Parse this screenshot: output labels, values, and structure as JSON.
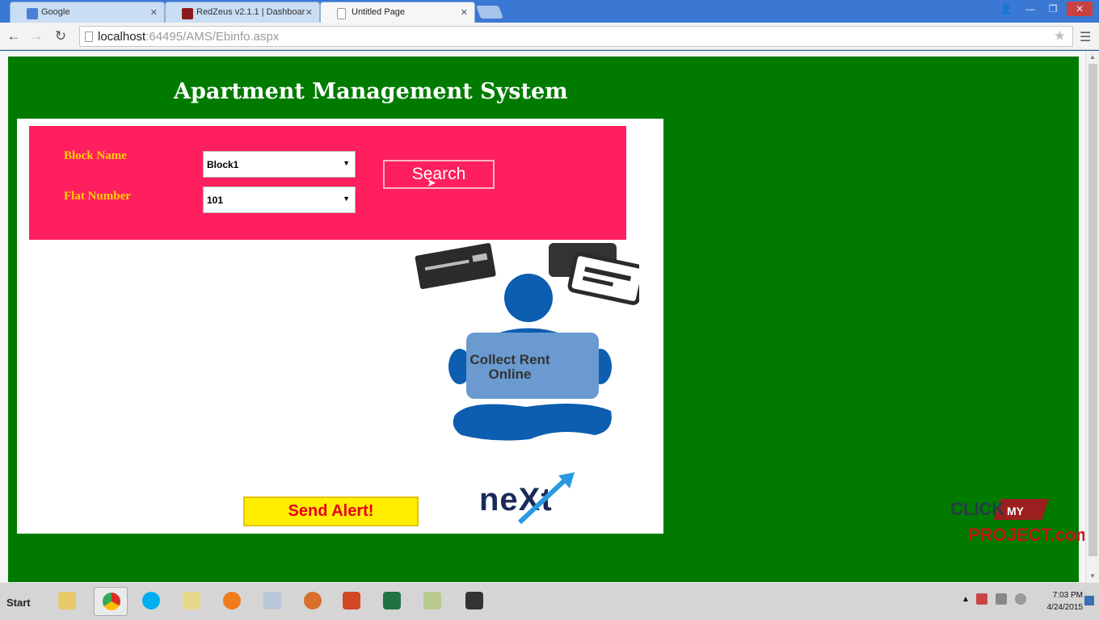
{
  "browser": {
    "tabs": [
      {
        "label": "Google",
        "icon": "google-favicon"
      },
      {
        "label": "RedZeus v2.1.1 | Dashboar",
        "icon": "redzeus-favicon"
      },
      {
        "label": "Untitled Page",
        "icon": "page-favicon"
      }
    ],
    "url_host": "localhost",
    "url_path": ":64495/AMS/Ebinfo.aspx",
    "window_controls": {
      "user": "👤",
      "minimize": "—",
      "maximize": "❐",
      "close": "✕"
    }
  },
  "page": {
    "title": "Apartment Management System",
    "form": {
      "block_label": "Block Name",
      "block_value": "Block1",
      "flat_label": "Flat Number",
      "flat_value": "101",
      "search_label": "Search"
    },
    "illustration_text_line1": "Collect Rent",
    "illustration_text_line2": "Online",
    "alert_label": "Send Alert!",
    "logo_text": "neXt",
    "watermark_line1": "CLICK",
    "watermark_line2": "MY",
    "watermark_line3": "PROJECT.com",
    "colors": {
      "page_bg": "#007b00",
      "form_bg": "#ff1f5e",
      "label_color": "#ffd200",
      "alert_bg": "#ffee00",
      "alert_text": "#e5001a"
    }
  },
  "taskbar": {
    "start_label": "Start",
    "apps": [
      "file-explorer",
      "chrome",
      "skype",
      "folder",
      "firefox",
      "network-tool",
      "color-app",
      "powerpoint",
      "excel",
      "notepad",
      "camera-app"
    ],
    "clock_time": "7:03 PM",
    "clock_date": "4/24/2015"
  }
}
